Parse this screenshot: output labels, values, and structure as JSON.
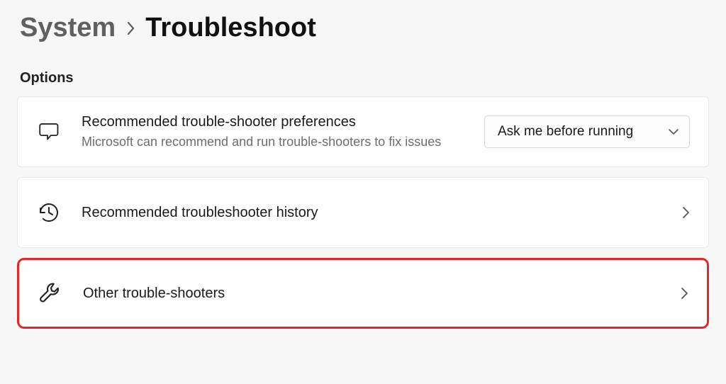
{
  "breadcrumb": {
    "parent": "System",
    "current": "Troubleshoot"
  },
  "section_label": "Options",
  "cards": {
    "preferences": {
      "title": "Recommended trouble-shooter preferences",
      "subtitle": "Microsoft can recommend and run trouble-shooters to fix issues",
      "dropdown_value": "Ask me before running"
    },
    "history": {
      "title": "Recommended troubleshooter history"
    },
    "other": {
      "title": "Other trouble-shooters"
    }
  }
}
